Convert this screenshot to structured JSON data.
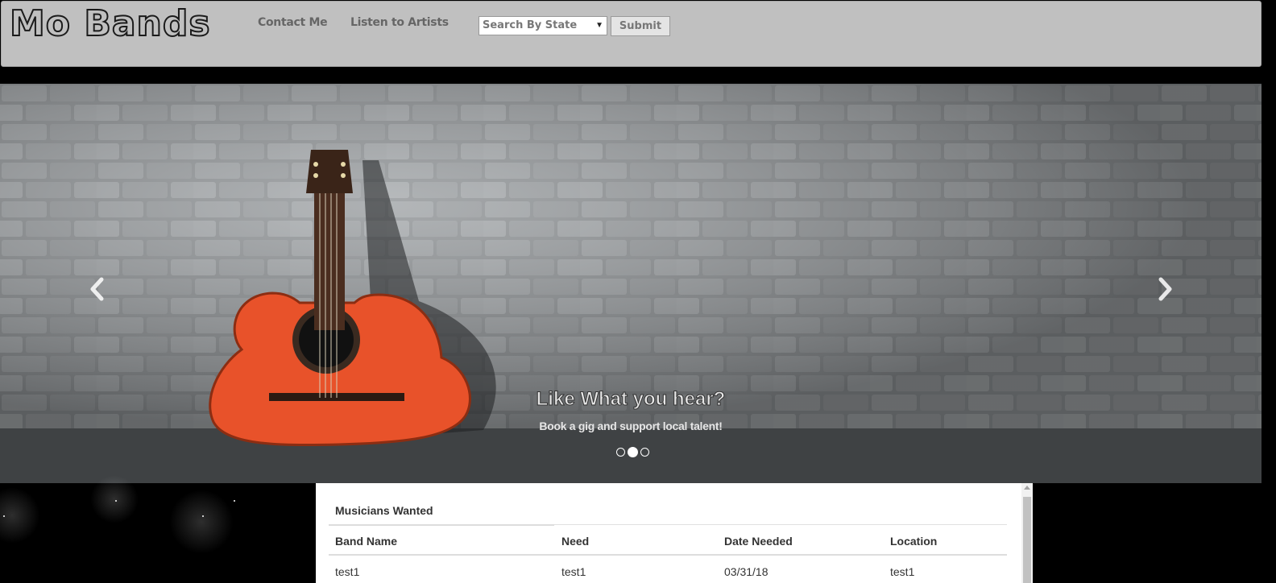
{
  "header": {
    "brand": "Mo Bands",
    "nav_links": [
      "Contact Me",
      "Listen to Artists"
    ],
    "search": {
      "selected": "Search By State",
      "submit_label": "Submit"
    }
  },
  "carousel": {
    "caption_title": "Like What you hear?",
    "caption_subtitle": "Book a gig and support local talent!",
    "active_slide": 2,
    "slide_count": 3,
    "accent_color": "#e8522a"
  },
  "musicians_table": {
    "title": "Musicians Wanted",
    "columns": [
      "Band Name",
      "Need",
      "Date Needed",
      "Location"
    ],
    "rows": [
      [
        "test1",
        "test1",
        "03/31/18",
        "test1"
      ]
    ]
  }
}
